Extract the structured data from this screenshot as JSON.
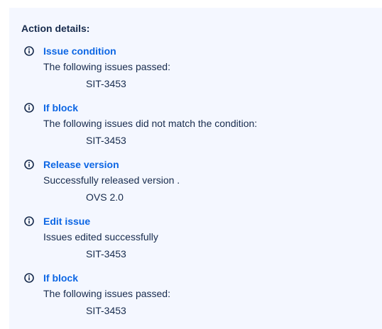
{
  "panel": {
    "heading": "Action details:"
  },
  "entries": [
    {
      "title": "Issue condition",
      "description": "The following issues passed:",
      "value": "SIT-3453",
      "icon": "info-icon"
    },
    {
      "title": "If block",
      "description": "The following issues did not match the condition:",
      "value": "SIT-3453",
      "icon": "info-icon"
    },
    {
      "title": "Release version",
      "description": "Successfully released version .",
      "value": "OVS 2.0",
      "icon": "info-icon"
    },
    {
      "title": "Edit issue",
      "description": "Issues edited successfully",
      "value": "SIT-3453",
      "icon": "info-icon"
    },
    {
      "title": "If block",
      "description": "The following issues passed:",
      "value": "SIT-3453",
      "icon": "info-icon"
    }
  ],
  "colors": {
    "panel_background": "#f4f7ff",
    "link": "#0c66e4",
    "text": "#172b4d"
  }
}
